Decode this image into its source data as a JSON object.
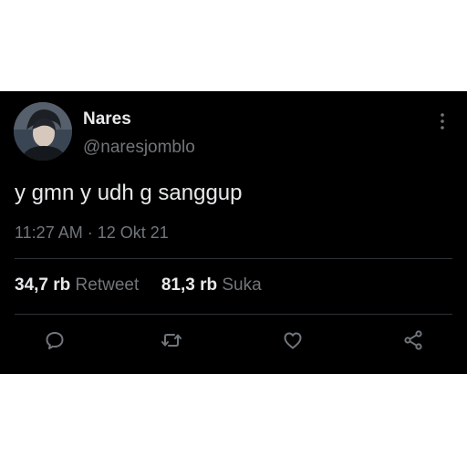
{
  "tweet": {
    "display_name": "Nares",
    "username": "@naresjomblo",
    "text": "y gmn y udh g sanggup",
    "time": "11:27 AM",
    "separator": "·",
    "date": "12 Okt 21",
    "retweet_count": "34,7 rb",
    "retweet_label": "Retweet",
    "like_count": "81,3 rb",
    "like_label": "Suka"
  },
  "icons": {
    "more": "more-vertical-icon",
    "reply": "reply-icon",
    "retweet": "retweet-icon",
    "like": "heart-icon",
    "share": "share-icon"
  },
  "colors": {
    "background": "#000000",
    "text": "#e7e9ea",
    "secondary_text": "#71767b",
    "divider": "#2f3336"
  }
}
